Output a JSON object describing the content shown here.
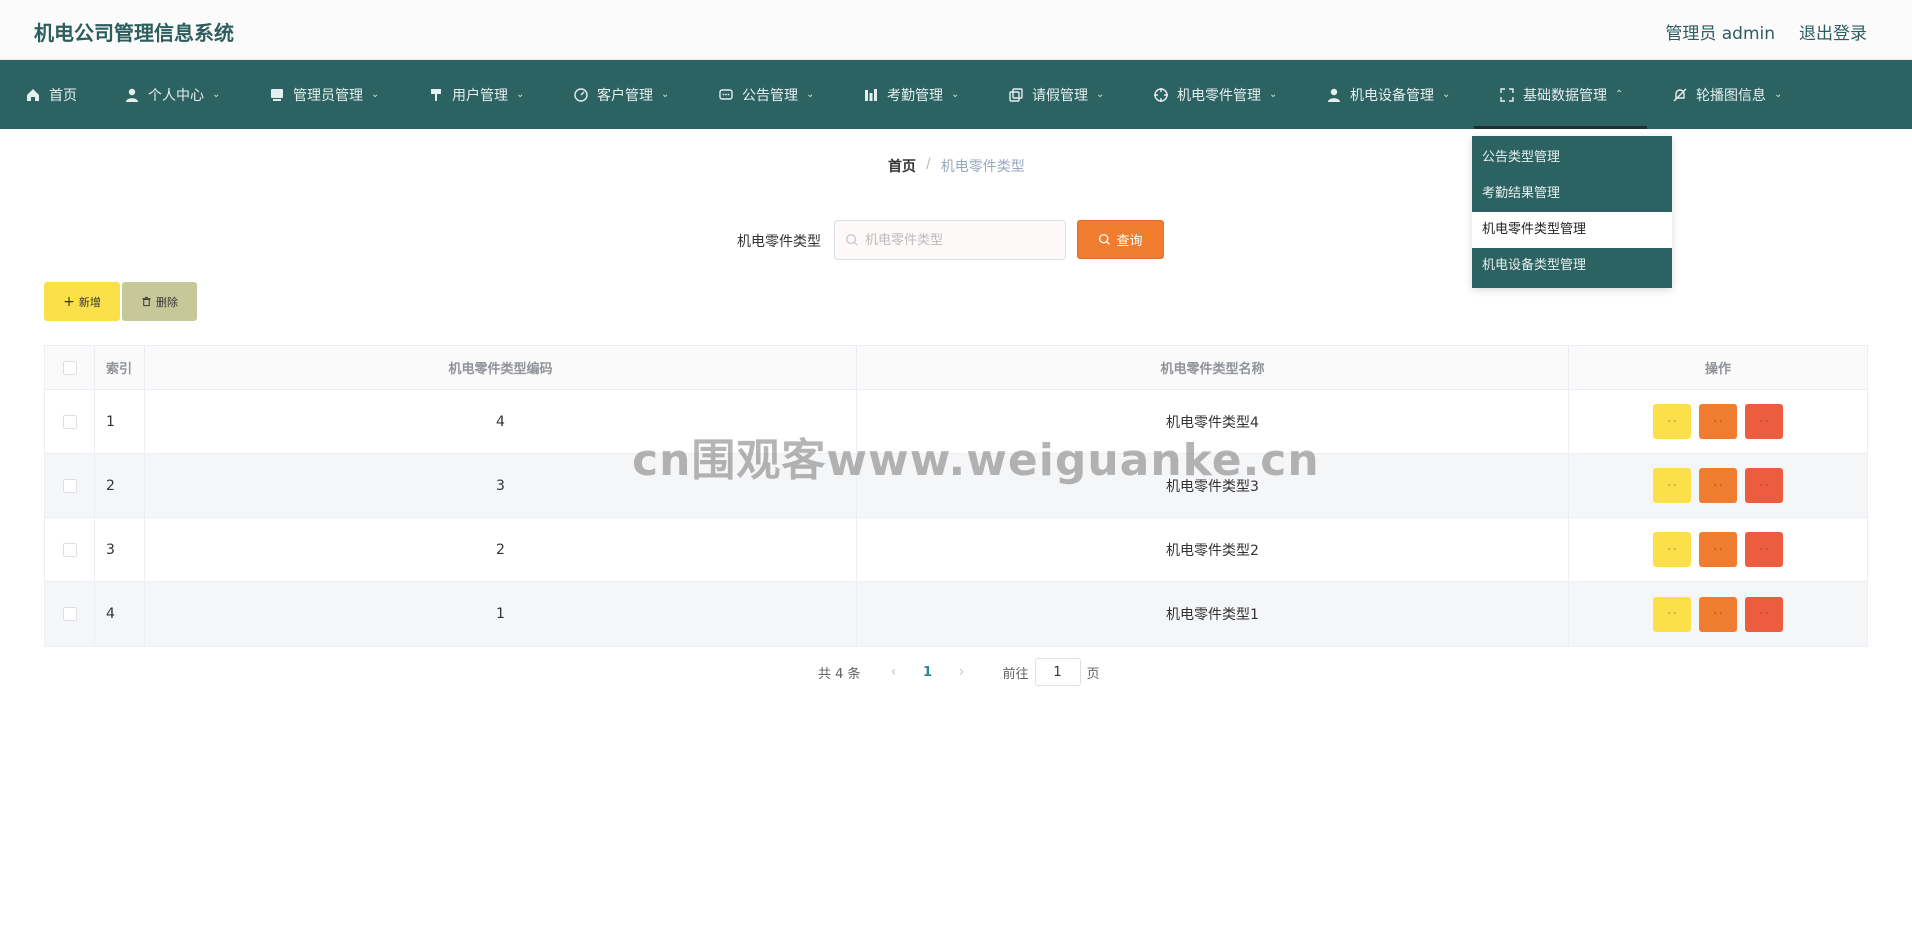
{
  "header": {
    "app_title": "机电公司管理信息系统",
    "user_label": "管理员 admin",
    "logout_label": "退出登录"
  },
  "nav": {
    "items": [
      {
        "label": "首页",
        "icon": "home-icon"
      },
      {
        "label": "个人中心",
        "icon": "user-icon"
      },
      {
        "label": "管理员管理",
        "icon": "admin-icon"
      },
      {
        "label": "用户管理",
        "icon": "users-icon"
      },
      {
        "label": "客户管理",
        "icon": "compass-icon"
      },
      {
        "label": "公告管理",
        "icon": "chat-icon"
      },
      {
        "label": "考勤管理",
        "icon": "chart-icon"
      },
      {
        "label": "请假管理",
        "icon": "copy-icon"
      },
      {
        "label": "机电零件管理",
        "icon": "crosshair-icon"
      },
      {
        "label": "机电设备管理",
        "icon": "person-icon"
      },
      {
        "label": "基础数据管理",
        "icon": "fullscreen-icon"
      },
      {
        "label": "轮播图信息",
        "icon": "bell-off-icon"
      }
    ],
    "dropdown": [
      {
        "label": "公告类型管理"
      },
      {
        "label": "考勤结果管理"
      },
      {
        "label": "机电零件类型管理"
      },
      {
        "label": "机电设备类型管理"
      }
    ]
  },
  "breadcrumb": {
    "home": "首页",
    "separator": "/",
    "current": "机电零件类型"
  },
  "search": {
    "label": "机电零件类型",
    "placeholder": "机电零件类型",
    "query_label": "查询"
  },
  "actions": {
    "add_label": "新增",
    "delete_label": "删除"
  },
  "table": {
    "headers": {
      "index": "索引",
      "code": "机电零件类型编码",
      "name": "机电零件类型名称",
      "operation": "操作"
    },
    "rows": [
      {
        "index": "1",
        "code": "4",
        "name": "机电零件类型4"
      },
      {
        "index": "2",
        "code": "3",
        "name": "机电零件类型3"
      },
      {
        "index": "3",
        "code": "2",
        "name": "机电零件类型2"
      },
      {
        "index": "4",
        "code": "1",
        "name": "机电零件类型1"
      }
    ],
    "row_button_text": "· ·"
  },
  "pagination": {
    "total_label": "共 4 条",
    "current_page": "1",
    "goto_label": "前往",
    "goto_value": "1",
    "page_suffix": "页"
  },
  "watermark": "cn围观客www.weiguanke.cn",
  "colors": {
    "primary": "#2d6262",
    "query": "#f07c2f",
    "add": "#fce04a",
    "delete": "#c6c89a",
    "danger": "#ec5d3f"
  }
}
